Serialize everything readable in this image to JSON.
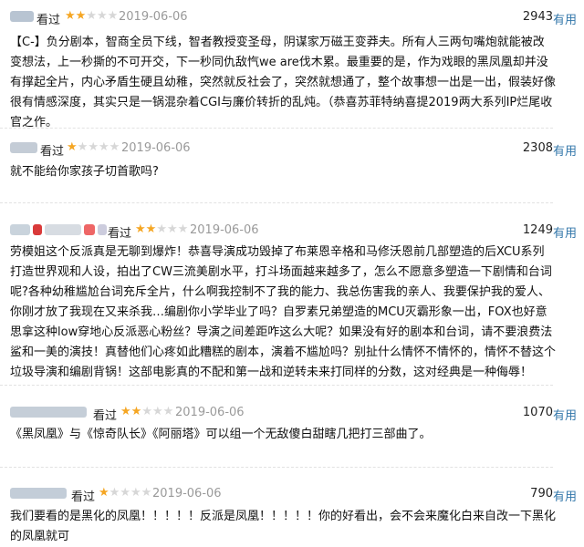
{
  "reviews": [
    {
      "watched_label": "看过",
      "rating": 2,
      "date": "2019-06-06",
      "votes": "2943",
      "useful_label": "有用",
      "text": "【C-】负分剧本，智商全员下线，智者教授变圣母，阴谋家万磁王变莽夫。所有人三两句嘴炮就能被改变想法，上一秒撕的不可开交，下一秒同仇敌忾we are伐木累。最重要的是，作为戏眼的黑凤凰却并没有撑起全片，内心矛盾生硬且幼稚，突然就反社会了，突然就想通了，整个故事想一出是一出，假装好像很有情感深度，其实只是一锅混杂着CGI与廉价转折的乱炖。（恭喜苏菲特纳喜提2019两大系列IP烂尾收官之作。"
    },
    {
      "watched_label": "看过",
      "rating": 1,
      "date": "2019-06-06",
      "votes": "2308",
      "useful_label": "有用",
      "text": "就不能给你家孩子切首歌吗?"
    },
    {
      "watched_label": "看过",
      "rating": 2,
      "date": "2019-06-06",
      "votes": "1249",
      "useful_label": "有用",
      "text": "劳模姐这个反派真是无聊到爆炸！恭喜导演成功毁掉了布莱恩辛格和马修沃恩前几部塑造的后XCU系列打造世界观和人设，拍出了CW三流美剧水平，打斗场面越来越多了，怎么不愿意多塑造一下剧情和台词呢?各种幼稚尴尬台词充斥全片，什么啊我控制不了我的能力、我总伤害我的亲人、我要保护我的爱人、你刚才放了我现在又来杀我…编剧你小学毕业了吗？自罗素兄弟塑造的MCU灭霸形象一出，FOX也好意思拿这种low穿地心反派恶心粉丝？导演之间差距咋这么大呢？如果没有好的剧本和台词，请不要浪费法鲨和一美的演技！真替他们心疼如此糟糕的剧本，演着不尴尬吗？别扯什么情怀不情怀的，情怀不替这个垃圾导演和编剧背锅！这部电影真的不配和第一战和逆转未来打同样的分数，这对经典是一种侮辱！"
    },
    {
      "watched_label": "看过",
      "rating": 2,
      "date": "2019-06-06",
      "votes": "1070",
      "useful_label": "有用",
      "text": "《黑凤凰》与《惊奇队长》《阿丽塔》可以组一个无敌傻白甜瞎几把打三部曲了。"
    },
    {
      "watched_label": "看过",
      "rating": 1,
      "date": "2019-06-06",
      "votes": "790",
      "useful_label": "有用",
      "text": "我们要看的是黑化的凤凰！！！！！反派是凤凰！！！！！你的好看出，会不会来魔化白来自改一下黑化的凤凰就可"
    }
  ],
  "colors": {
    "star_on": "#f5a623",
    "star_off": "#d7d7d7",
    "link": "#3377aa",
    "date": "#9a9a9a"
  },
  "icons": [
    "star-icon"
  ]
}
